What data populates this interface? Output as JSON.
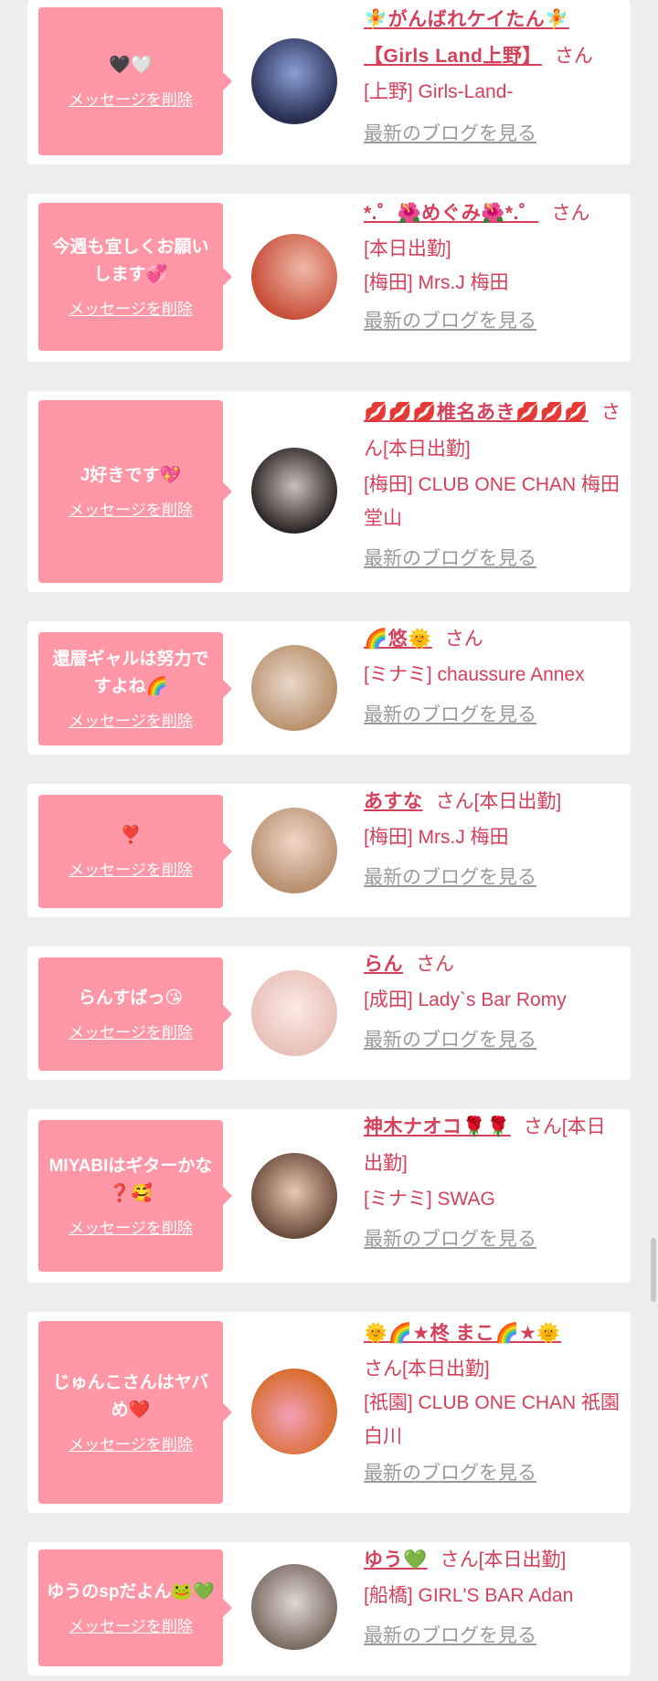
{
  "delete_label": "メッセージを削除",
  "blog_label": "最新のブログを見る",
  "san": "さん",
  "colors": {
    "bubble": "#ff97a7",
    "name": "#d5405a",
    "link": "#9a9a9a",
    "background": "#eeeeee"
  },
  "cards": [
    {
      "message": "🖤🤍",
      "name": "🧚がんばれケイたん🧚【Girls Land上野】",
      "status": "",
      "shop": "[上野] Girls-Land-",
      "avatar_colors": [
        "#2a2f52",
        "#8aa0d8"
      ]
    },
    {
      "message": "今週も宜しくお願いします💞",
      "name": "*.゜🌺めぐみ🌺*.゜",
      "status": "[本日出勤]",
      "shop": "[梅田] Mrs.J 梅田",
      "avatar_colors": [
        "#c8503a",
        "#f0b8a8"
      ]
    },
    {
      "message": "J好きです💖",
      "name": "💋💋💋椎名あき💋💋💋",
      "status": "[本日出勤]",
      "shop": "[梅田] CLUB ONE CHAN 梅田堂山",
      "avatar_colors": [
        "#2a2424",
        "#c9c0bc"
      ]
    },
    {
      "message": "還暦ギャルは努力ですよね🌈",
      "name": "🌈悠🌞",
      "status": "",
      "shop": "[ミナミ] chaussure Annex",
      "avatar_colors": [
        "#b8906a",
        "#e8d8cc"
      ]
    },
    {
      "message": "❣️",
      "name": "あすな",
      "status": "[本日出勤]",
      "shop": "[梅田] Mrs.J 梅田",
      "avatar_colors": [
        "#b89070",
        "#f0d8c8"
      ]
    },
    {
      "message": "らんすばっ😘",
      "name": "らん",
      "status": "",
      "shop": "[成田] Lady`s Bar Romy",
      "avatar_colors": [
        "#e8c0b8",
        "#fbeae4"
      ]
    },
    {
      "message": "MIYABIはギターかな❓🥰",
      "name": "神木ナオコ🌹🌹",
      "status": "[本日出勤]",
      "shop": "[ミナミ] SWAG",
      "avatar_colors": [
        "#6a4a3a",
        "#e8c8b0"
      ]
    },
    {
      "message": "じゅんこさんはヤバめ❤️",
      "name": "🌞🌈★柊 まこ🌈★🌞",
      "status": "[本日出勤]",
      "shop": "[祇園] CLUB ONE CHAN 祇園白川",
      "avatar_colors": [
        "#d86a2a",
        "#f2a0b8"
      ]
    },
    {
      "message": "ゆうのspだよん🐸💚",
      "name": "ゆう💚",
      "status": "[本日出勤]",
      "shop": "[船橋] GIRL'S BAR Adan",
      "avatar_colors": [
        "#7a6a60",
        "#e0d8d4"
      ]
    }
  ]
}
